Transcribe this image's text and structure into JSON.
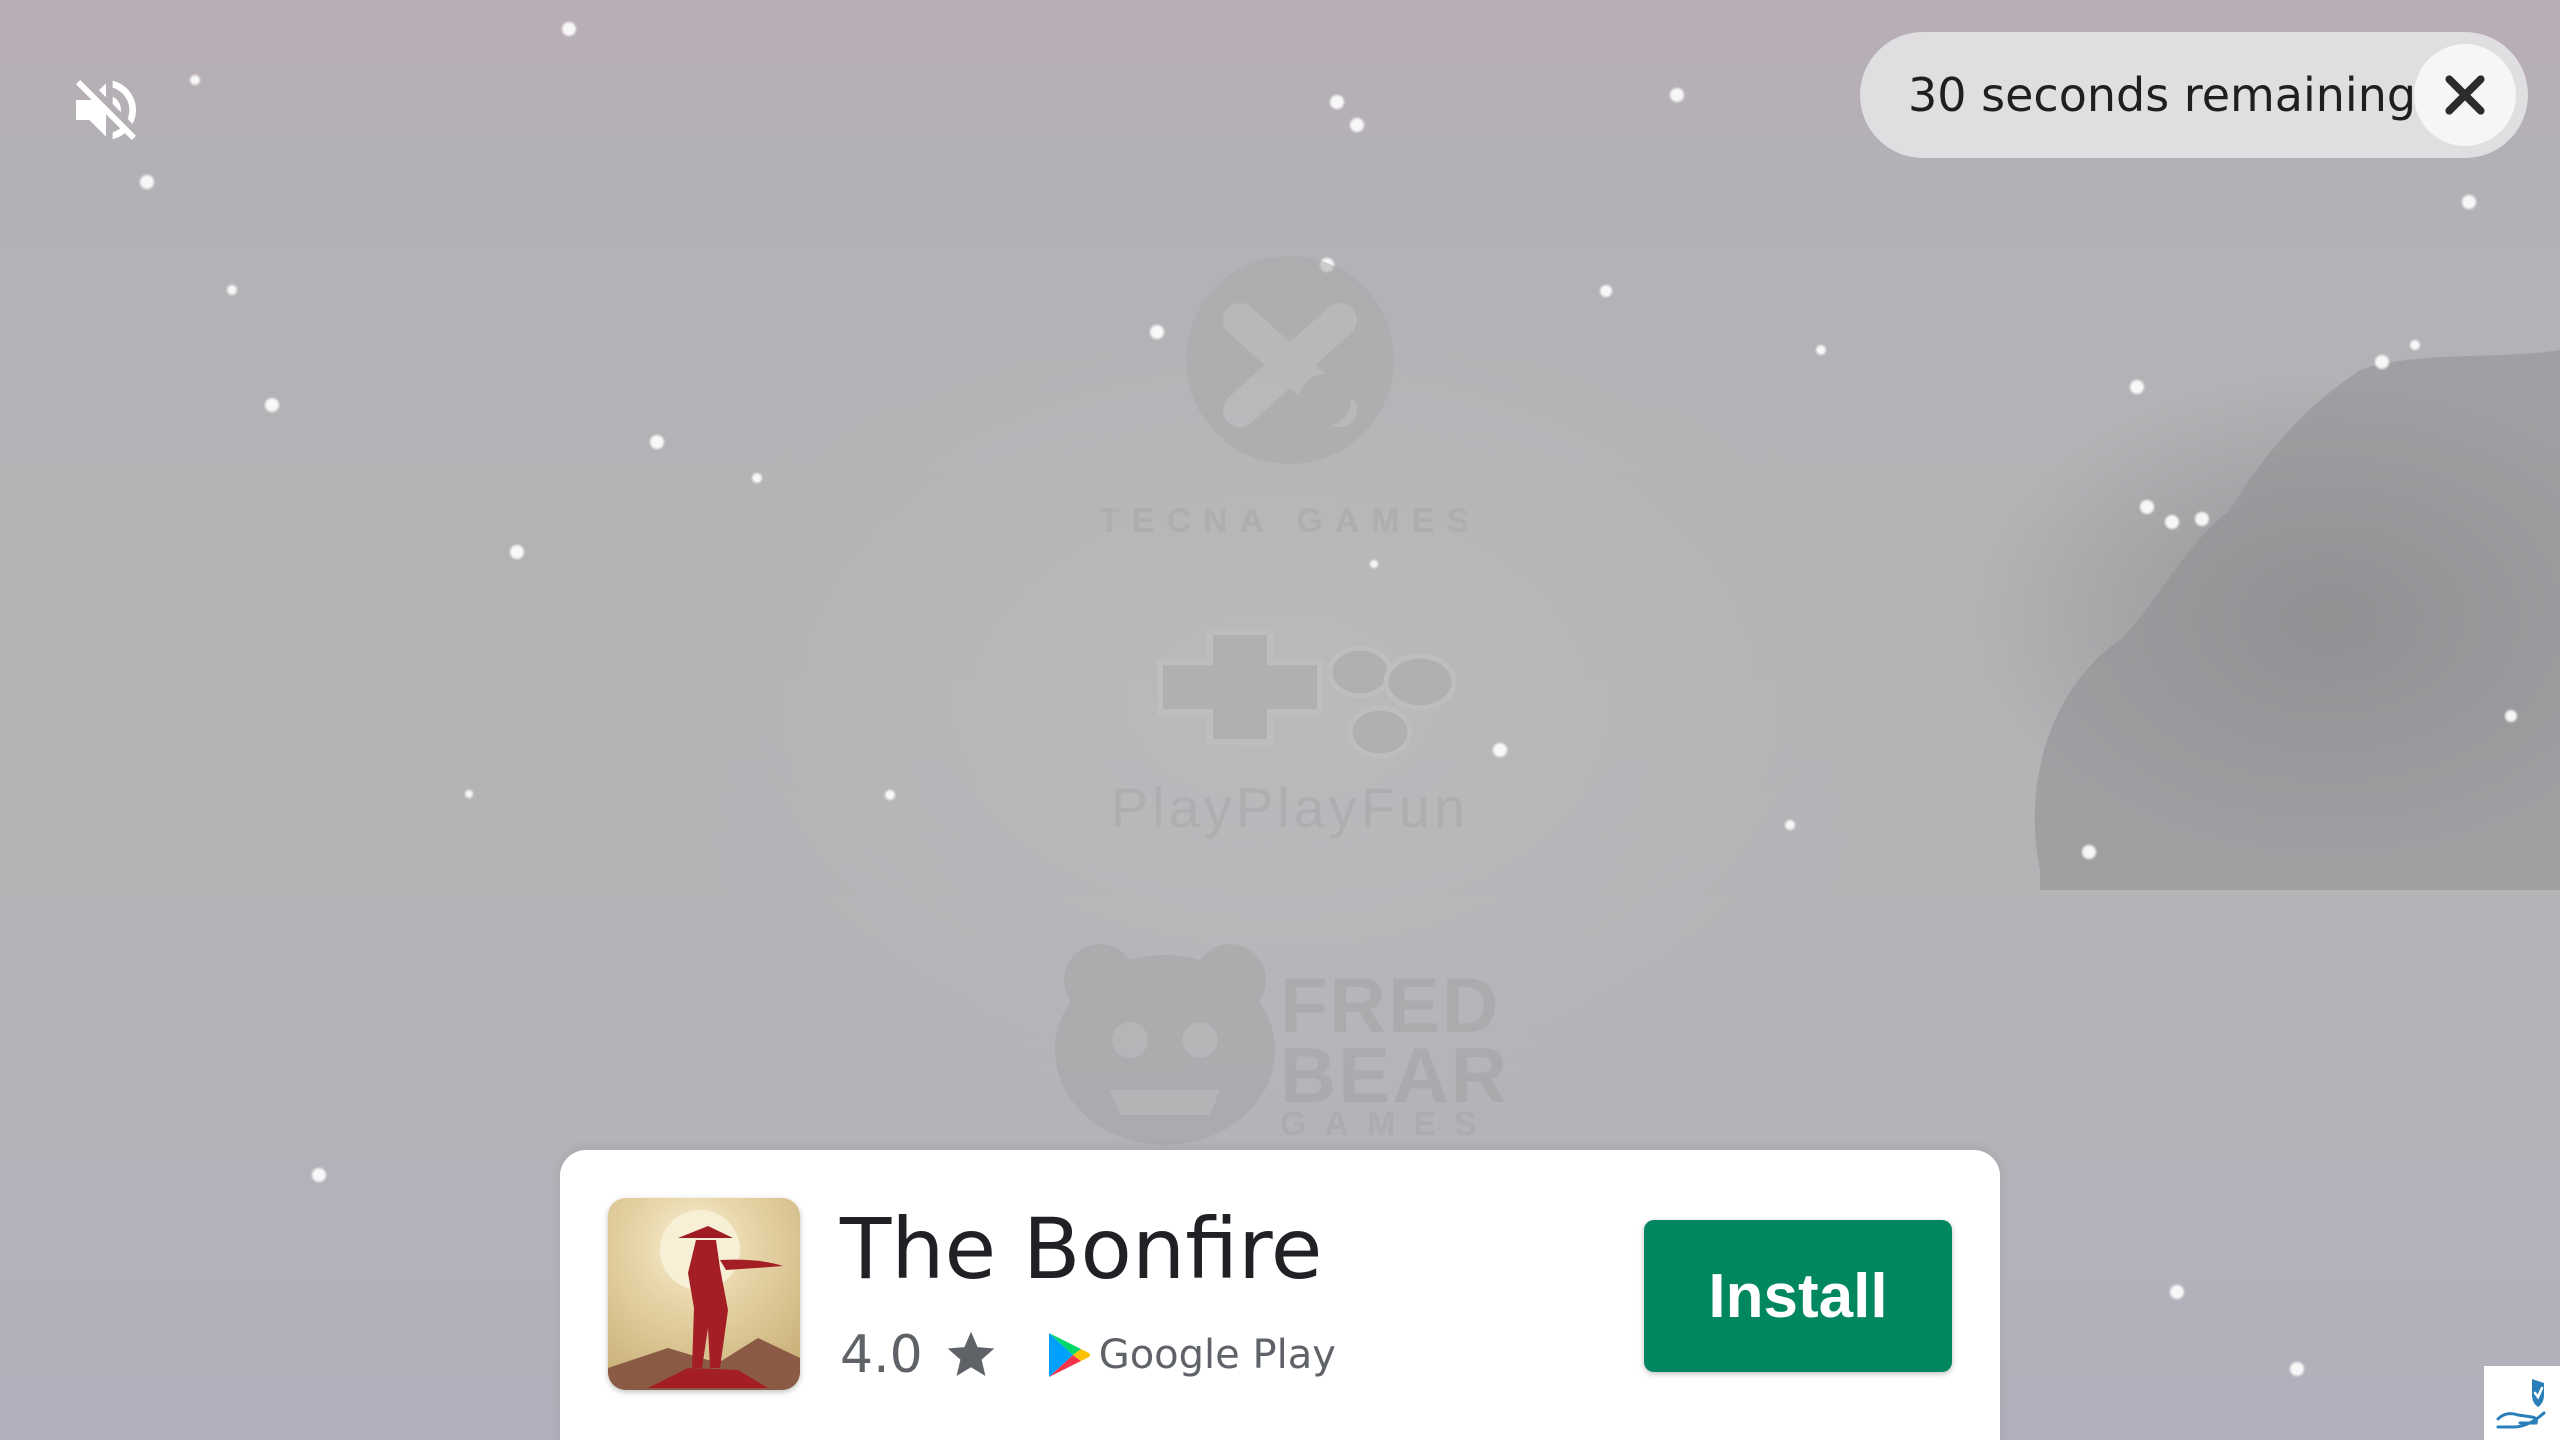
{
  "ad": {
    "sound_icon": "volume-muted-icon",
    "countdown_text": "30 seconds remaining",
    "close_icon": "close-icon",
    "privacy_icon": "adchoices-icon"
  },
  "splash_logos": {
    "studio_1": "TECNA GAMES",
    "studio_2": "PlayPlayFun",
    "studio_3": "FRED BEAR",
    "studio_3_sub": "GAMES"
  },
  "app_card": {
    "title": "The Bonfire",
    "rating": "4.0",
    "rating_icon": "star-icon",
    "store_name": "Google Play",
    "install_label": "Install",
    "colors": {
      "install_button": "#01875f",
      "title": "#202124",
      "meta": "#5f6368"
    }
  }
}
